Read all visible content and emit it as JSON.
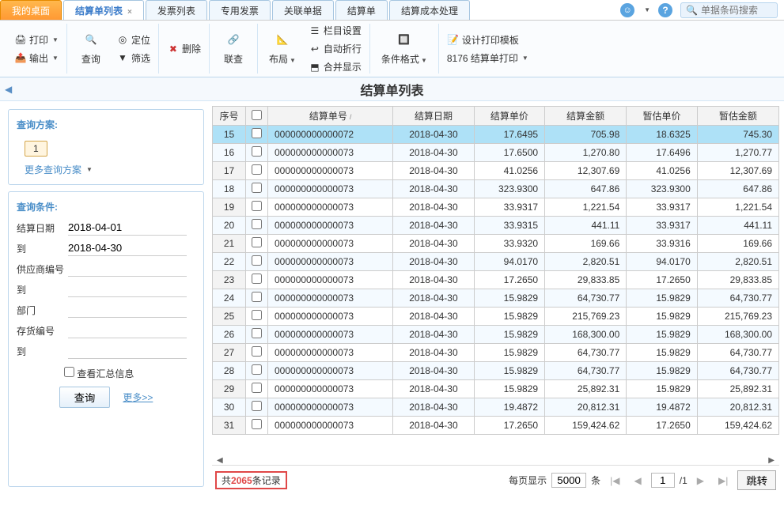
{
  "tabs": [
    "我的桌面",
    "结算单列表",
    "发票列表",
    "专用发票",
    "关联单据",
    "结算单",
    "结算成本处理"
  ],
  "search_placeholder": "单据条码搜索",
  "toolbar": {
    "print": "打印",
    "output": "输出",
    "query": "查询",
    "locate": "定位",
    "filter": "筛选",
    "delete": "删除",
    "link": "联查",
    "layout": "布局",
    "col_set": "栏目设置",
    "auto_wrap": "自动折行",
    "merge": "合并显示",
    "cond_fmt": "条件格式",
    "design_tpl": "设计打印模板",
    "print_count": "8176 结算单打印"
  },
  "page_title": "结算单列表",
  "query_scheme": {
    "title": "查询方案:",
    "num": "1",
    "more": "更多查询方案"
  },
  "query_cond": {
    "title": "查询条件:",
    "date_label": "结算日期",
    "date_from": "2018-04-01",
    "to_label": "到",
    "date_to": "2018-04-30",
    "supplier": "供应商编号",
    "dept": "部门",
    "stock": "存货编号",
    "summary_chk": "查看汇总信息",
    "btn": "查询",
    "more": "更多>>"
  },
  "headers": [
    "序号",
    "",
    "结算单号",
    "结算日期",
    "结算单价",
    "结算金额",
    "暂估单价",
    "暂估金额"
  ],
  "rows": [
    {
      "seq": "15",
      "no": "000000000000072",
      "date": "2018-04-30",
      "up": "17.6495",
      "amt": "705.98",
      "eup": "18.6325",
      "eamt": "745.30",
      "sel": true
    },
    {
      "seq": "16",
      "no": "000000000000073",
      "date": "2018-04-30",
      "up": "17.6500",
      "amt": "1,270.80",
      "eup": "17.6496",
      "eamt": "1,270.77"
    },
    {
      "seq": "17",
      "no": "000000000000073",
      "date": "2018-04-30",
      "up": "41.0256",
      "amt": "12,307.69",
      "eup": "41.0256",
      "eamt": "12,307.69"
    },
    {
      "seq": "18",
      "no": "000000000000073",
      "date": "2018-04-30",
      "up": "323.9300",
      "amt": "647.86",
      "eup": "323.9300",
      "eamt": "647.86"
    },
    {
      "seq": "19",
      "no": "000000000000073",
      "date": "2018-04-30",
      "up": "33.9317",
      "amt": "1,221.54",
      "eup": "33.9317",
      "eamt": "1,221.54"
    },
    {
      "seq": "20",
      "no": "000000000000073",
      "date": "2018-04-30",
      "up": "33.9315",
      "amt": "441.11",
      "eup": "33.9317",
      "eamt": "441.11"
    },
    {
      "seq": "21",
      "no": "000000000000073",
      "date": "2018-04-30",
      "up": "33.9320",
      "amt": "169.66",
      "eup": "33.9316",
      "eamt": "169.66"
    },
    {
      "seq": "22",
      "no": "000000000000073",
      "date": "2018-04-30",
      "up": "94.0170",
      "amt": "2,820.51",
      "eup": "94.0170",
      "eamt": "2,820.51"
    },
    {
      "seq": "23",
      "no": "000000000000073",
      "date": "2018-04-30",
      "up": "17.2650",
      "amt": "29,833.85",
      "eup": "17.2650",
      "eamt": "29,833.85"
    },
    {
      "seq": "24",
      "no": "000000000000073",
      "date": "2018-04-30",
      "up": "15.9829",
      "amt": "64,730.77",
      "eup": "15.9829",
      "eamt": "64,730.77"
    },
    {
      "seq": "25",
      "no": "000000000000073",
      "date": "2018-04-30",
      "up": "15.9829",
      "amt": "215,769.23",
      "eup": "15.9829",
      "eamt": "215,769.23"
    },
    {
      "seq": "26",
      "no": "000000000000073",
      "date": "2018-04-30",
      "up": "15.9829",
      "amt": "168,300.00",
      "eup": "15.9829",
      "eamt": "168,300.00"
    },
    {
      "seq": "27",
      "no": "000000000000073",
      "date": "2018-04-30",
      "up": "15.9829",
      "amt": "64,730.77",
      "eup": "15.9829",
      "eamt": "64,730.77"
    },
    {
      "seq": "28",
      "no": "000000000000073",
      "date": "2018-04-30",
      "up": "15.9829",
      "amt": "64,730.77",
      "eup": "15.9829",
      "eamt": "64,730.77"
    },
    {
      "seq": "29",
      "no": "000000000000073",
      "date": "2018-04-30",
      "up": "15.9829",
      "amt": "25,892.31",
      "eup": "15.9829",
      "eamt": "25,892.31"
    },
    {
      "seq": "30",
      "no": "000000000000073",
      "date": "2018-04-30",
      "up": "19.4872",
      "amt": "20,812.31",
      "eup": "19.4872",
      "eamt": "20,812.31"
    },
    {
      "seq": "31",
      "no": "000000000000073",
      "date": "2018-04-30",
      "up": "17.2650",
      "amt": "159,424.62",
      "eup": "17.2650",
      "eamt": "159,424.62"
    }
  ],
  "footer": {
    "prefix": "共",
    "count": "2065",
    "suffix": "条记录",
    "per_page": "每页显示",
    "psize": "5000",
    "unit": "条",
    "page": "1",
    "total": "/1",
    "jump": "跳转"
  }
}
